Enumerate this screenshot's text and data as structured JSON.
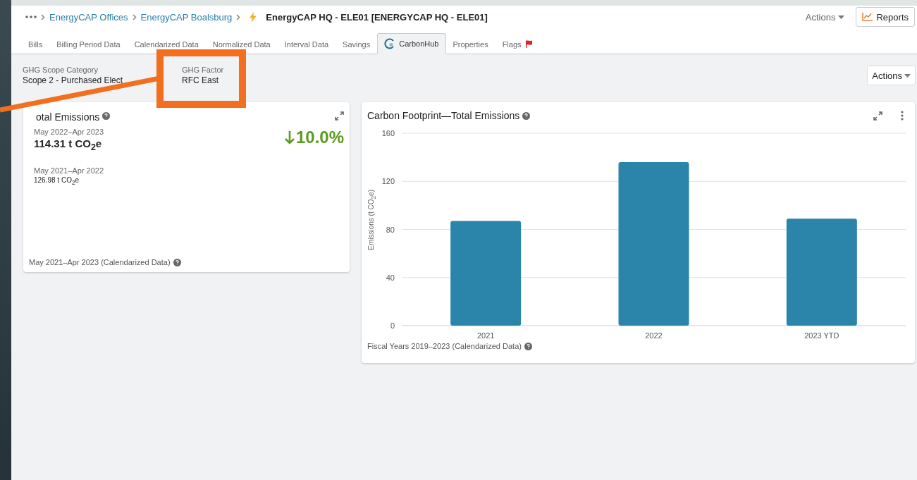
{
  "breadcrumb": {
    "items": [
      "EnergyCAP Offices",
      "EnergyCAP Boalsburg"
    ],
    "title": "EnergyCAP HQ - ELE01 [ENERGYCAP HQ - ELE01]"
  },
  "header_actions": {
    "actions": "Actions",
    "reports": "Reports"
  },
  "tabs": [
    {
      "label": "Bills",
      "selected": false,
      "kind": "plain"
    },
    {
      "label": "Billing Period Data",
      "selected": false,
      "kind": "plain"
    },
    {
      "label": "Calendarized Data",
      "selected": false,
      "kind": "plain"
    },
    {
      "label": "Normalized Data",
      "selected": false,
      "kind": "plain"
    },
    {
      "label": "Interval Data",
      "selected": false,
      "kind": "plain"
    },
    {
      "label": "Savings",
      "selected": false,
      "kind": "plain"
    },
    {
      "label": "CarbonHub",
      "selected": true,
      "kind": "logo"
    },
    {
      "label": "Properties",
      "selected": false,
      "kind": "plain"
    },
    {
      "label": "Flags",
      "selected": false,
      "kind": "flag"
    }
  ],
  "fields": [
    {
      "label": "GHG Scope Category",
      "value": "Scope 2 - Purchased Elect"
    },
    {
      "label": "GHG Factor",
      "value": "RFC East"
    }
  ],
  "content_actions": "Actions",
  "emissions_card": {
    "title": "otal Emissions",
    "current_period": "May 2022–Apr 2023",
    "current_value": "114.31 t CO$_{2}$e",
    "change": "10.0%",
    "previous_period": "May 2021–Apr 2022",
    "previous_value": "126.98 t CO$_{2}$e",
    "footer": "May 2021–Apr 2023 (Calendarized Data)"
  },
  "footprint_card": {
    "title": "Carbon Footprint—Total Emissions",
    "footer": "Fiscal Years 2019–2023 (Calendarized Data)",
    "chart_data": {
      "type": "bar",
      "ylabel": "Emissions (t CO$_{2}$e)",
      "categories": [
        "2021",
        "2022",
        "2023 YTD"
      ],
      "series": [
        {
          "color": "#2b84aa",
          "values": [
            87,
            136,
            89
          ]
        }
      ],
      "grid": true,
      "ylim": [
        0,
        160
      ],
      "yticks": [
        0,
        40,
        80,
        120,
        160
      ]
    }
  }
}
